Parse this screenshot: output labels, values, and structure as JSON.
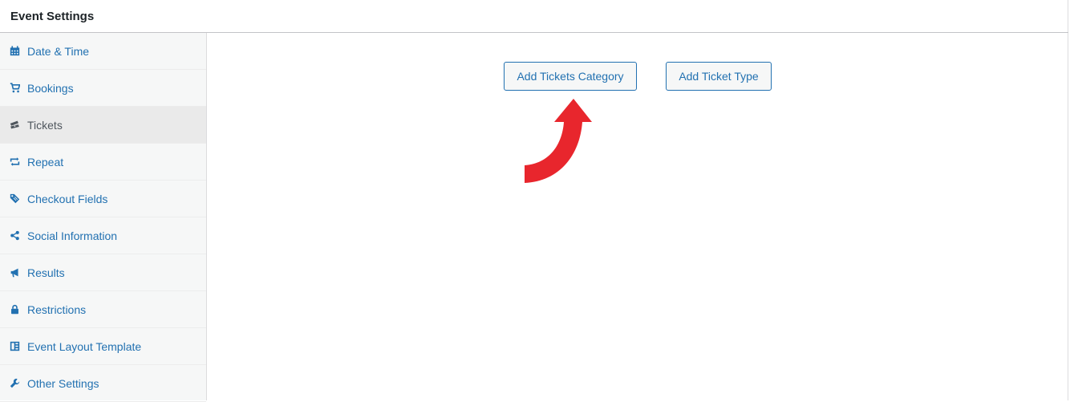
{
  "header": {
    "title": "Event Settings"
  },
  "sidebar": {
    "items": [
      {
        "label": "Date & Time",
        "icon": "calendar-icon",
        "active": false
      },
      {
        "label": "Bookings",
        "icon": "cart-icon",
        "active": false
      },
      {
        "label": "Tickets",
        "icon": "tickets-icon",
        "active": true
      },
      {
        "label": "Repeat",
        "icon": "repeat-icon",
        "active": false
      },
      {
        "label": "Checkout Fields",
        "icon": "tag-icon",
        "active": false
      },
      {
        "label": "Social Information",
        "icon": "share-icon",
        "active": false
      },
      {
        "label": "Results",
        "icon": "megaphone-icon",
        "active": false
      },
      {
        "label": "Restrictions",
        "icon": "lock-icon",
        "active": false
      },
      {
        "label": "Event Layout Template",
        "icon": "layout-icon",
        "active": false
      },
      {
        "label": "Other Settings",
        "icon": "wrench-icon",
        "active": false
      }
    ]
  },
  "main": {
    "add_category_label": "Add Tickets Category",
    "add_type_label": "Add Ticket Type"
  },
  "colors": {
    "link": "#2271b1",
    "active_text": "#50575e",
    "annotation_arrow": "#e8262d"
  }
}
